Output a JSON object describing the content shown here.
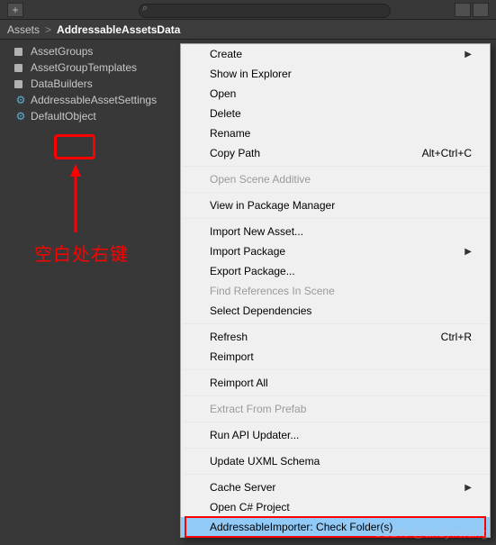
{
  "toolbar": {
    "plus_label": "+",
    "search_placeholder": "",
    "search_icon": "⌕"
  },
  "breadcrumb": {
    "root": "Assets",
    "sep": ">",
    "current": "AddressableAssetsData"
  },
  "tree": {
    "items": [
      {
        "label": "AssetGroups",
        "icon": "folder"
      },
      {
        "label": "AssetGroupTemplates",
        "icon": "folder"
      },
      {
        "label": "DataBuilders",
        "icon": "folder"
      },
      {
        "label": "AddressableAssetSettings",
        "icon": "so"
      },
      {
        "label": "DefaultObject",
        "icon": "so"
      }
    ]
  },
  "annotation": {
    "text": "空白处右键"
  },
  "menu": {
    "items": [
      {
        "label": "Create",
        "submenu": true
      },
      {
        "label": "Show in Explorer"
      },
      {
        "label": "Open"
      },
      {
        "label": "Delete"
      },
      {
        "label": "Rename"
      },
      {
        "label": "Copy Path",
        "shortcut": "Alt+Ctrl+C"
      },
      {
        "sep": true
      },
      {
        "label": "Open Scene Additive",
        "disabled": true
      },
      {
        "sep": true
      },
      {
        "label": "View in Package Manager"
      },
      {
        "sep": true
      },
      {
        "label": "Import New Asset..."
      },
      {
        "label": "Import Package",
        "submenu": true
      },
      {
        "label": "Export Package..."
      },
      {
        "label": "Find References In Scene",
        "disabled": true
      },
      {
        "label": "Select Dependencies"
      },
      {
        "sep": true
      },
      {
        "label": "Refresh",
        "shortcut": "Ctrl+R"
      },
      {
        "label": "Reimport"
      },
      {
        "sep": true
      },
      {
        "label": "Reimport All"
      },
      {
        "sep": true
      },
      {
        "label": "Extract From Prefab",
        "disabled": true
      },
      {
        "sep": true
      },
      {
        "label": "Run API Updater..."
      },
      {
        "sep": true
      },
      {
        "label": "Update UXML Schema"
      },
      {
        "sep": true
      },
      {
        "label": "Cache Server",
        "submenu": true
      },
      {
        "label": "Open C# Project"
      },
      {
        "label": "AddressableImporter: Check Folder(s)",
        "highlighted": true
      }
    ]
  },
  "watermark": "CSDN @andy#wang"
}
